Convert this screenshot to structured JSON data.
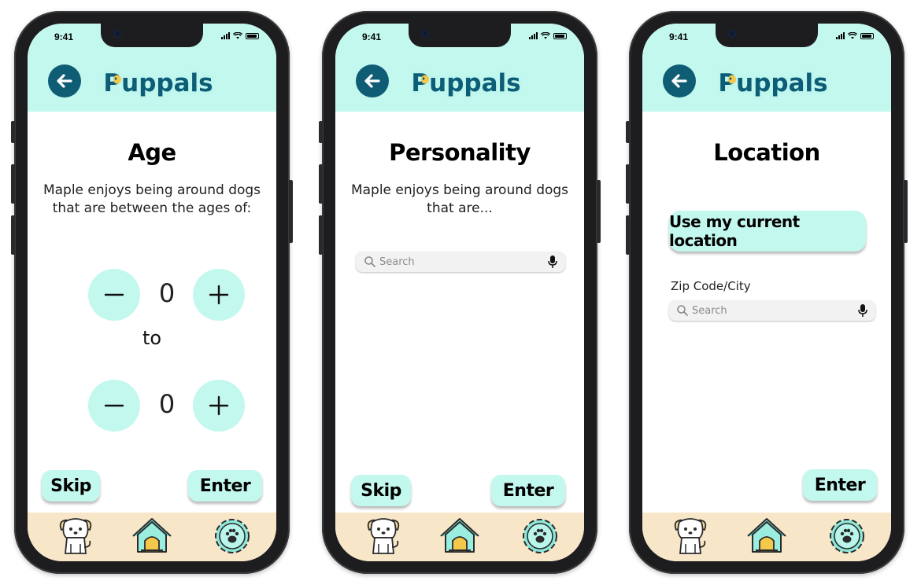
{
  "app": {
    "name": "Puppals",
    "time": "9:41"
  },
  "colors": {
    "mint": "#c3f8ee",
    "teal_dark": "#0f5d74",
    "tabbar": "#f8e6c8",
    "logo_fill": "#0d5d77",
    "logo_glow": "#bff6ee"
  },
  "screens": [
    {
      "title": "Age",
      "description": "Maple enjoys being around dogs that are between the ages of:",
      "min_age": "0",
      "connector": "to",
      "max_age": "0",
      "skip_label": "Skip",
      "enter_label": "Enter"
    },
    {
      "title": "Personality",
      "description": "Maple enjoys being around dogs that are...",
      "search_placeholder": "Search",
      "skip_label": "Skip",
      "enter_label": "Enter"
    },
    {
      "title": "Location",
      "location_button": "Use my current location",
      "zip_label": "Zip Code/City",
      "search_placeholder": "Search",
      "enter_label": "Enter"
    }
  ],
  "tabbar": {
    "icons": [
      "dog-icon",
      "dog-house-icon",
      "settings-paw-icon"
    ]
  }
}
